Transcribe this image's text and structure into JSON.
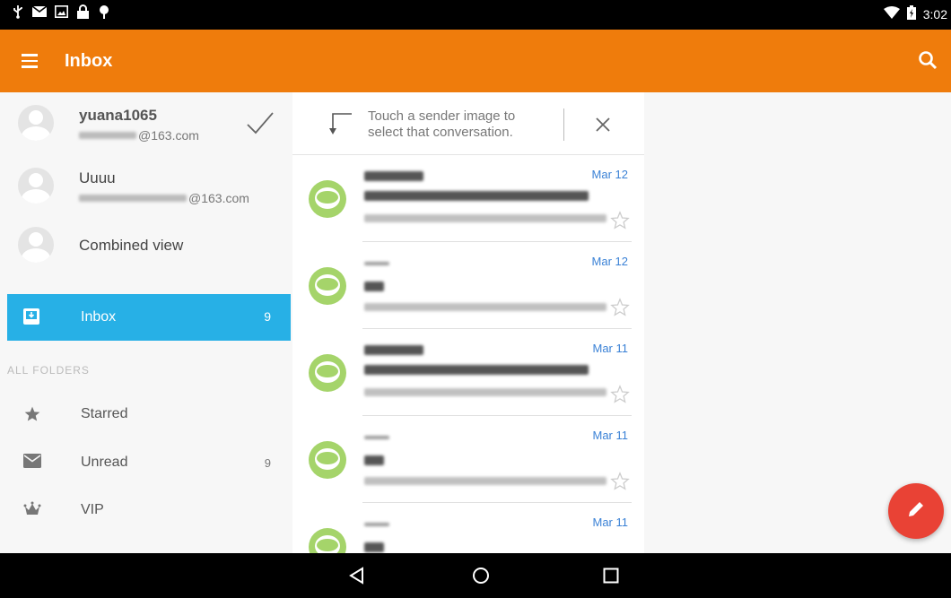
{
  "status_bar": {
    "time": "3:02",
    "left_icons": [
      "usb-icon",
      "mail-notification-icon",
      "image-notification-icon",
      "lock-icon",
      "debug-icon"
    ],
    "right_icons": [
      "wifi-icon",
      "battery-icon"
    ]
  },
  "app_bar": {
    "title": "Inbox",
    "color": "#ef7c0c"
  },
  "drawer": {
    "accounts": [
      {
        "name": "yuana1065",
        "email_suffix": "@163.com",
        "active": true
      },
      {
        "name": "Uuuu",
        "email_suffix": "@163.com",
        "active": false
      },
      {
        "name": "Combined view"
      }
    ],
    "selected_folder": {
      "label": "Inbox",
      "count": "9"
    },
    "section_header": "ALL FOLDERS",
    "folders": [
      {
        "label": "Starred",
        "count": ""
      },
      {
        "label": "Unread",
        "count": "9"
      },
      {
        "label": "VIP",
        "count": ""
      }
    ],
    "accent": "#27b0e6"
  },
  "tip": {
    "line1": "Touch a sender image to",
    "line2": "select that conversation."
  },
  "mails": [
    {
      "date": "Mar 12"
    },
    {
      "date": "Mar 12"
    },
    {
      "date": "Mar 11"
    },
    {
      "date": "Mar 11"
    },
    {
      "date": "Mar 11"
    }
  ],
  "fab": {
    "icon": "compose-pencil-icon",
    "color": "#e94235"
  }
}
